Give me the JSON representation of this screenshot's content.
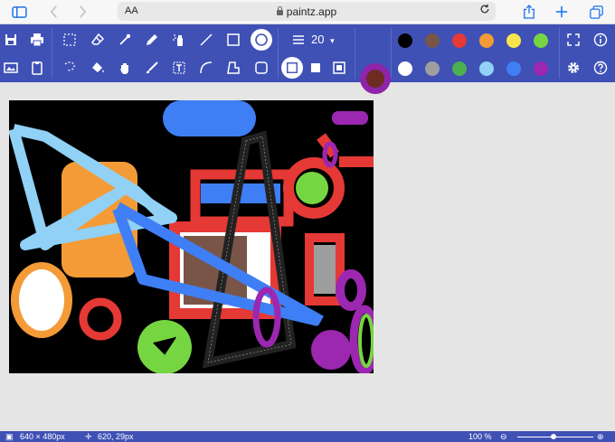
{
  "browser": {
    "text_size_label": "AA",
    "url": "paintz.app"
  },
  "toolbar": {
    "brush_size": "20",
    "brush_size_dropdown": "▾",
    "palette_top": [
      "#000000",
      "#795548",
      "#e53935",
      "#f49b37",
      "#f8e44c",
      "#76d641"
    ],
    "palette_bottom": [
      "#ffffff",
      "#9e9e9e",
      "#4caf50",
      "#90d1f5",
      "#3f7ff5",
      "#9c27b0"
    ],
    "outline_color": "#8e24aa",
    "fill_color": "#6d2b22"
  },
  "status": {
    "canvas_size": "640 × 480px",
    "cursor_position": "620, 29px",
    "zoom": "100 %"
  }
}
